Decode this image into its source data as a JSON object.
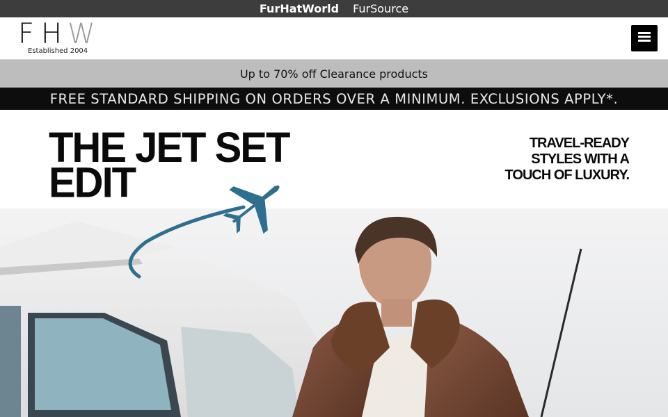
{
  "topbar": {
    "site1": "FurHatWorld",
    "site2": "FurSource"
  },
  "header": {
    "logo_f": "F",
    "logo_h": "H",
    "logo_w": "W",
    "tagline": "Established 2004",
    "menu_icon": "hamburger-menu-icon"
  },
  "promo": {
    "text": "Up to 70% off Clearance products"
  },
  "shipping": {
    "text": "FREE STANDARD SHIPPING ON ORDERS OVER A MINIMUM. EXCLUSIONS APPLY*."
  },
  "hero": {
    "title_line1": "THE JET SET",
    "title_line2": "EDIT",
    "sub_line1": "TRAVEL-READY",
    "sub_line2": "STYLES WITH A",
    "sub_line3": "TOUCH OF LUXURY.",
    "plane_color": "#2e6e8e",
    "image_subject": "man in brown shearling aviator jacket beside small airplane"
  },
  "colors": {
    "topbar_bg": "#3d3d3d",
    "promo_bg": "#bdbdbd",
    "shipbar_bg": "#0d0d0d",
    "accent_blue": "#2e6e8e"
  }
}
